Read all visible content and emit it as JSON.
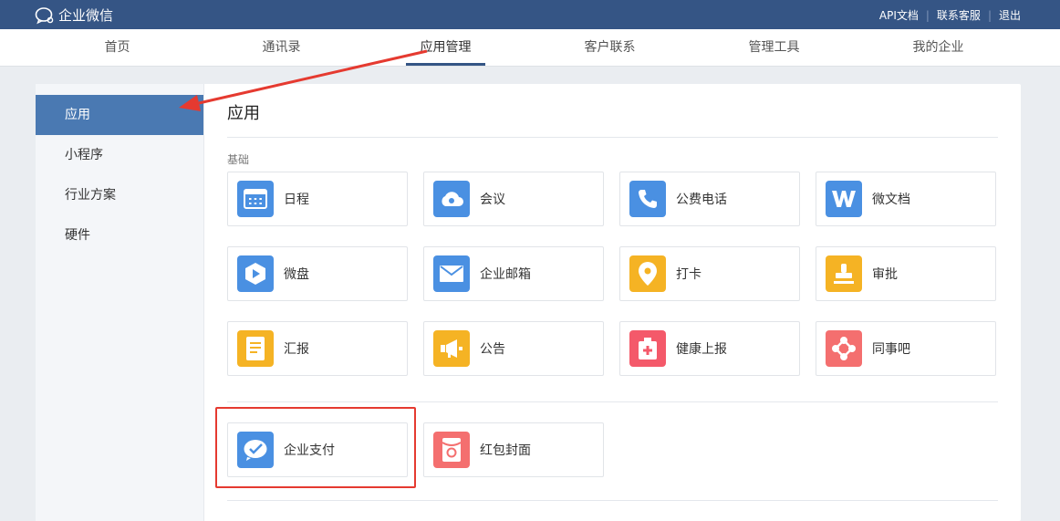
{
  "app": {
    "brand": "企业微信"
  },
  "toplinks": {
    "api_docs": "API文档",
    "support": "联系客服",
    "logout": "退出",
    "separator": "|"
  },
  "nav": {
    "tabs": [
      {
        "label": "首页"
      },
      {
        "label": "通讯录"
      },
      {
        "label": "应用管理"
      },
      {
        "label": "客户联系"
      },
      {
        "label": "管理工具"
      },
      {
        "label": "我的企业"
      }
    ]
  },
  "sidebar": {
    "items": [
      {
        "label": "应用"
      },
      {
        "label": "小程序"
      },
      {
        "label": "行业方案"
      },
      {
        "label": "硬件"
      }
    ]
  },
  "main": {
    "title": "应用",
    "section_basic": "基础",
    "basic_apps": [
      {
        "label": "日程",
        "icon": "calendar-icon",
        "color": "#4a90e2"
      },
      {
        "label": "会议",
        "icon": "meeting-cloud-icon",
        "color": "#4a90e2"
      },
      {
        "label": "公费电话",
        "icon": "phone-icon",
        "color": "#4a90e2"
      },
      {
        "label": "微文档",
        "icon": "document-w-icon",
        "color": "#4a90e2"
      },
      {
        "label": "微盘",
        "icon": "drive-icon",
        "color": "#4a90e2"
      },
      {
        "label": "企业邮箱",
        "icon": "mail-icon",
        "color": "#4a90e2"
      },
      {
        "label": "打卡",
        "icon": "location-pin-icon",
        "color": "#f5b324"
      },
      {
        "label": "审批",
        "icon": "stamp-icon",
        "color": "#f5b324"
      },
      {
        "label": "汇报",
        "icon": "report-icon",
        "color": "#f5b324"
      },
      {
        "label": "公告",
        "icon": "megaphone-icon",
        "color": "#f5b324"
      },
      {
        "label": "健康上报",
        "icon": "health-kit-icon",
        "color": "#f4596a"
      },
      {
        "label": "同事吧",
        "icon": "network-icon",
        "color": "#f46f6f"
      }
    ],
    "payment_apps": [
      {
        "label": "企业支付",
        "icon": "payment-icon",
        "color": "#4a90e2"
      },
      {
        "label": "红包封面",
        "icon": "red-envelope-icon",
        "color": "#f46f6f"
      }
    ]
  },
  "annotation": {
    "arrow_color": "#e53a30",
    "box_color": "#e53a30"
  }
}
